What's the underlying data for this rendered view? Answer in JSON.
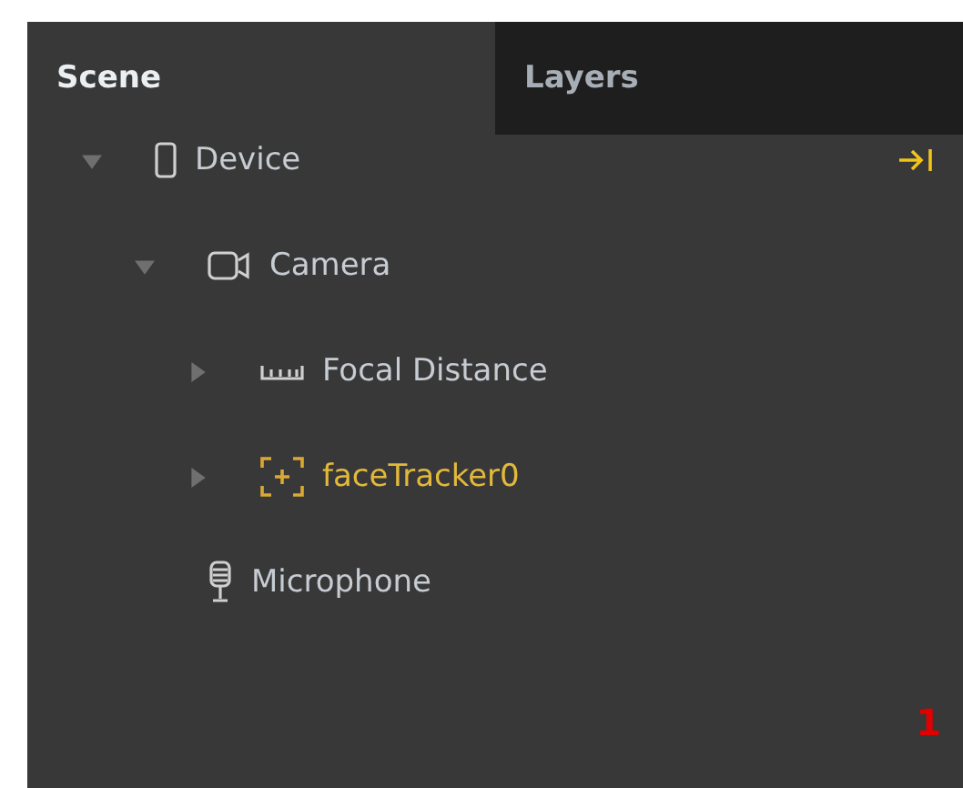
{
  "tabs": [
    {
      "label": "Scene",
      "selected": true
    },
    {
      "label": "Layers",
      "selected": false
    }
  ],
  "tree": [
    {
      "label": "Device",
      "kind": "device",
      "expanded": true,
      "children": [
        {
          "label": "Camera",
          "kind": "camera",
          "expanded": true,
          "children": [
            {
              "label": "Focal Distance",
              "kind": "ruler",
              "expanded": false
            },
            {
              "label": "faceTracker0",
              "kind": "tracker",
              "expanded": false
            }
          ]
        },
        {
          "label": "Microphone",
          "kind": "microphone"
        }
      ]
    }
  ],
  "marker": "1"
}
